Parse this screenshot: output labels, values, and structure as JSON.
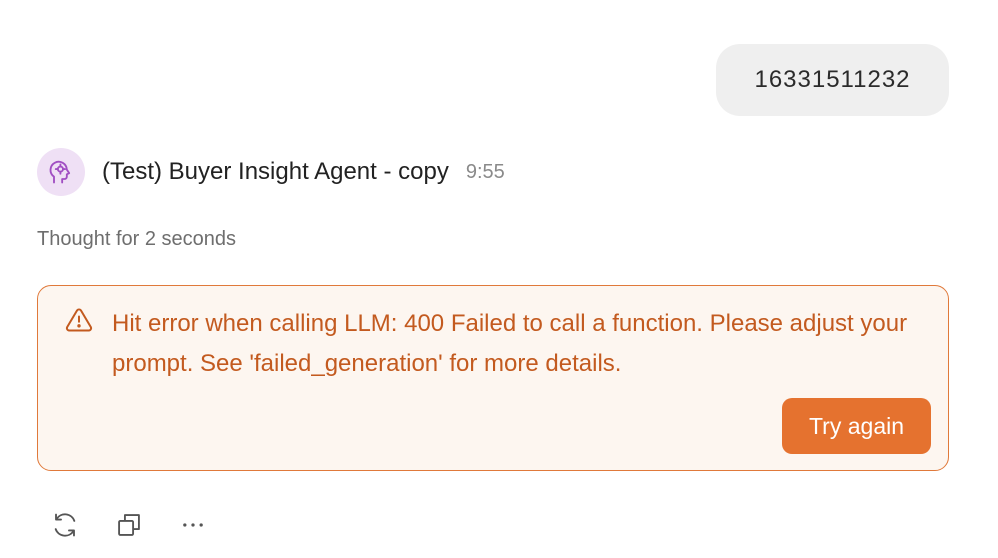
{
  "user_message": {
    "text": "16331511232"
  },
  "agent": {
    "name": "(Test) Buyer Insight Agent - copy",
    "time": "9:55",
    "avatar_icon": "head-gears-icon"
  },
  "thought": {
    "text": "Thought for 2 seconds"
  },
  "error": {
    "icon": "warning-triangle-icon",
    "message": "Hit error when calling LLM: 400 Failed to call a function. Please adjust your prompt. See 'failed_generation' for more details.",
    "retry_label": "Try again"
  },
  "actions": {
    "icons": [
      "refresh-icon",
      "copy-icon",
      "more-icon"
    ]
  },
  "colors": {
    "accent": "#e5722f",
    "error_text": "#c35a1f",
    "error_border": "#e0793a",
    "error_background": "#fdf6f0",
    "avatar_background": "#efe0f5",
    "avatar_icon": "#a14fc3",
    "user_bubble": "#efefef"
  }
}
